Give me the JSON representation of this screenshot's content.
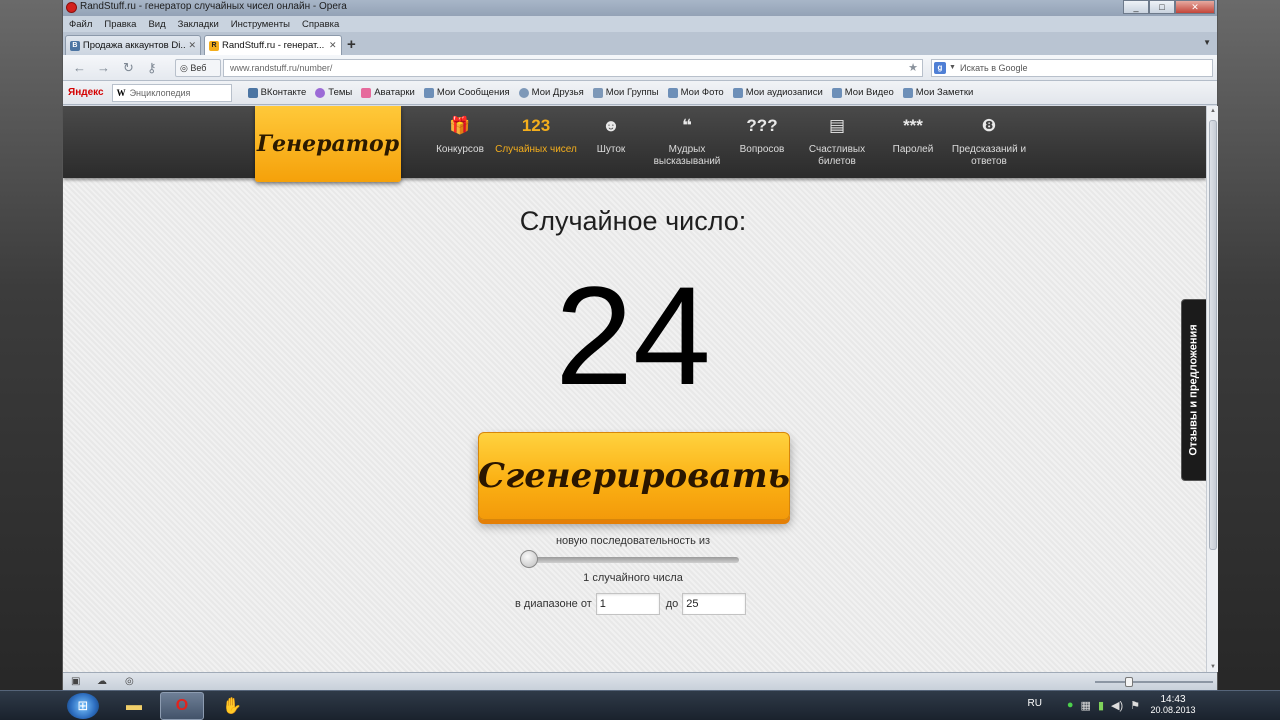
{
  "window": {
    "title": "RandStuff.ru - генератор случайных чисел онлайн - Opera",
    "controls": [
      "_",
      "□",
      "✕"
    ]
  },
  "menu": [
    "Файл",
    "Правка",
    "Вид",
    "Закладки",
    "Инструменты",
    "Справка"
  ],
  "tabs": [
    {
      "label": "Продажа аккаунтов Di...",
      "active": false
    },
    {
      "label": "RandStuff.ru - генерат...",
      "active": true
    }
  ],
  "address": {
    "web_label": "Веб",
    "url": "www.randstuff.ru/number/",
    "search_placeholder": "Искать в Google"
  },
  "bookmarks": {
    "yandex": "Яндекс",
    "wiki_placeholder": "Энциклопедия",
    "items": [
      "ВКонтакте",
      "Темы",
      "Аватарки",
      "Мои Сообщения",
      "Мои Друзья",
      "Мои Группы",
      "Мои Фото",
      "Мои аудиозаписи",
      "Мои Видео",
      "Мои Заметки"
    ]
  },
  "site": {
    "logo": "Генератор",
    "nav": [
      {
        "icon": "gift-icon",
        "glyph": "🎁",
        "label": "Конкурсов",
        "active": false
      },
      {
        "icon": "numbers-icon",
        "glyph": "123",
        "label": "Случайных чисел",
        "active": true
      },
      {
        "icon": "smile-icon",
        "glyph": "☻",
        "label": "Шуток",
        "active": false
      },
      {
        "icon": "quote-icon",
        "glyph": "❝",
        "label": "Мудрых высказываний",
        "active": false
      },
      {
        "icon": "question-icon",
        "glyph": "???",
        "label": "Вопросов",
        "active": false
      },
      {
        "icon": "ticket-icon",
        "glyph": "▤",
        "label": "Счастливых билетов",
        "active": false
      },
      {
        "icon": "password-icon",
        "glyph": "***",
        "label": "Паролей",
        "active": false
      },
      {
        "icon": "eightball-icon",
        "glyph": "❽",
        "label": "Предсказаний и ответов",
        "active": false
      }
    ],
    "heading": "Случайное число:",
    "result": "24",
    "generate_label": "Сгенерировать",
    "sequence_label": "новую последовательность из",
    "count_label": "1 случайного числа",
    "slider_value": 1,
    "range_from_label": "в диапазоне от",
    "range_from": "1",
    "range_to_label": "до",
    "range_to": "25",
    "feedback": "Отзывы и предложения"
  },
  "taskbar": {
    "lang": "RU",
    "time": "14:43",
    "date": "20.08.2013"
  }
}
